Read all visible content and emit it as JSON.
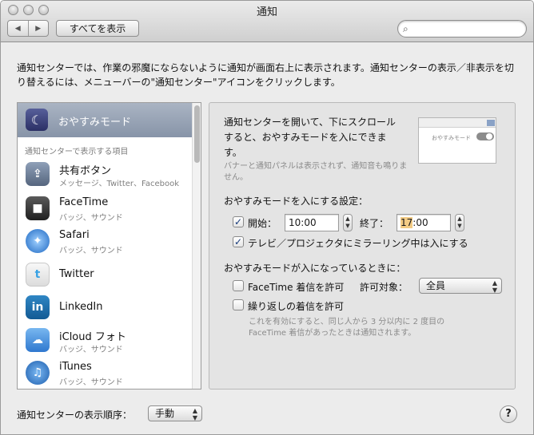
{
  "window": {
    "title": "通知"
  },
  "toolbar": {
    "back": "◀",
    "forward": "▶",
    "show_all": "すべてを表示",
    "search_placeholder": "",
    "search_icon": "🔍"
  },
  "intro": "通知センターでは、作業の邪魔にならないように通知が画面右上に表示されます。通知センターの表示／非表示を切り替えるには、メニューバーの\"通知センター\"アイコンをクリックします。",
  "sidebar": {
    "dnd_label": "おやすみモード",
    "dnd_icon": "moon-icon",
    "section_header": "通知センターで表示する項目",
    "apps": [
      {
        "name": "共有ボタン",
        "sub": "メッセージ、Twitter、Facebook",
        "icon": "share-icon",
        "color": "#5f6f86"
      },
      {
        "name": "FaceTime",
        "sub": "バッジ、サウンド",
        "icon": "facetime-icon",
        "color": "#3c3c3c"
      },
      {
        "name": "Safari",
        "sub": "バッジ、サウンド",
        "icon": "safari-icon",
        "color": "#2b7fd6"
      },
      {
        "name": "Twitter",
        "sub": "",
        "icon": "twitter-icon",
        "color": "#3aa2e4"
      },
      {
        "name": "LinkedIn",
        "sub": "",
        "icon": "linkedin-icon",
        "color": "#1d6ba8"
      },
      {
        "name": "iCloud フォト",
        "sub": "バッジ、サウンド",
        "icon": "icloud-icon",
        "color": "#4d95e0"
      },
      {
        "name": "iTunes",
        "sub": "バッジ、サウンド",
        "icon": "itunes-icon",
        "color": "#2f6fbd"
      }
    ]
  },
  "panel": {
    "desc": "通知センターを開いて、下にスクロールすると、おやすみモードを入にできます。",
    "note": "バナーと通知パネルは表示されず、通知音も鳴りません。",
    "thumb_label": "おやすみモード",
    "schedule_header": "おやすみモードを入にする設定：",
    "start_label": "開始：",
    "start_time": "10:00",
    "end_label": "終了：",
    "end_hour": "17",
    "end_min": ":00",
    "mirroring_label": "テレビ／プロジェクタにミラーリング中は入にする",
    "when_header": "おやすみモードが入になっているときに：",
    "allow_facetime_label": "FaceTime 着信を許可",
    "allow_target_label": "許可対象：",
    "allow_target_value": "全員",
    "repeat_label": "繰り返しの着信を許可",
    "repeat_note": "これを有効にすると、同じ人から 3 分以内に 2 度目の FaceTime 着信があったときは通知されます。",
    "check_mark": "✓"
  },
  "footer": {
    "order_label": "通知センターの表示順序：",
    "order_value": "手動",
    "help": "?"
  }
}
